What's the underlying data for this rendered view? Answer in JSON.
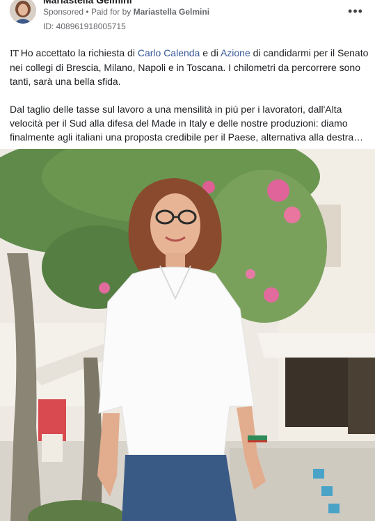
{
  "post": {
    "author_name": "Mariastella Gelmini",
    "sponsored_label": "Sponsored",
    "separator": "•",
    "paid_for_prefix": "Paid for by",
    "paid_for_name": "Mariastella Gelmini",
    "ad_id": "ID: 408961918005715",
    "more_icon": "more-horizontal-icon",
    "language_tag": "IT",
    "paragraph1": {
      "part1": "Ho accettato la richiesta di ",
      "link1": "Carlo Calenda",
      "part2": " e di ",
      "link2": "Azione",
      "part3": " di candidarmi per il Senato nei collegi di Brescia, Milano, Napoli e in Toscana. I chilometri da percorrere sono tanti, sarà una bella sfida."
    },
    "paragraph2": "Dal taglio delle tasse sul lavoro a una mensilità in più per i lavoratori, dall'Alta velocità per il Sud alla difesa del Made in Italy e delle nostre produzioni: diamo finalmente agli italiani una proposta credibile per il Paese, alternativa alla destra…"
  },
  "colors": {
    "link": "#385898",
    "meta": "#65676b",
    "text": "#1c1e21"
  }
}
